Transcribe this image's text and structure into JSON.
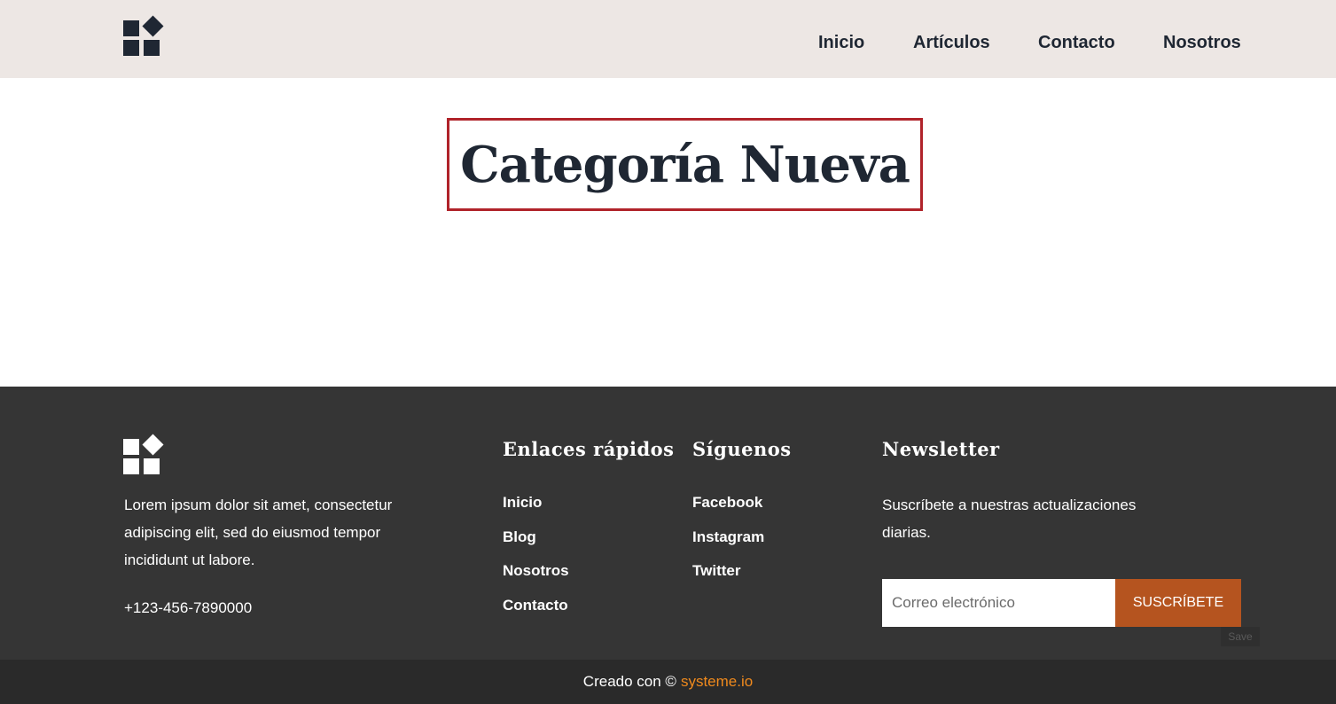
{
  "header": {
    "nav": [
      "Inicio",
      "Artículos",
      "Contacto",
      "Nosotros"
    ]
  },
  "main": {
    "title": "Categoría Nueva"
  },
  "footer": {
    "about": "Lorem ipsum dolor sit amet, consectetur adipiscing elit, sed do eiusmod tempor incididunt ut labore.",
    "phone": "+123-456-7890000",
    "quick_links": {
      "title": "Enlaces rápidos",
      "items": [
        "Inicio",
        "Blog",
        "Nosotros",
        "Contacto"
      ]
    },
    "follow": {
      "title": "Síguenos",
      "items": [
        "Facebook",
        "Instagram",
        "Twitter"
      ]
    },
    "newsletter": {
      "title": "Newsletter",
      "text": "Suscríbete a nuestras actualizaciones diarias.",
      "email_placeholder": "Correo electrónico",
      "button_label": "SUSCRÍBETE",
      "save_label": "Save"
    },
    "credit": {
      "prefix": "Creado con ©",
      "link": "systeme.io"
    }
  },
  "colors": {
    "header_bg": "#ede7e4",
    "text_dark": "#1f2733",
    "title_border": "#b0232a",
    "footer_bg": "#353535",
    "bottom_bg": "#2a2a2a",
    "button_bg": "#b5541f",
    "link_accent": "#f08a1d"
  }
}
